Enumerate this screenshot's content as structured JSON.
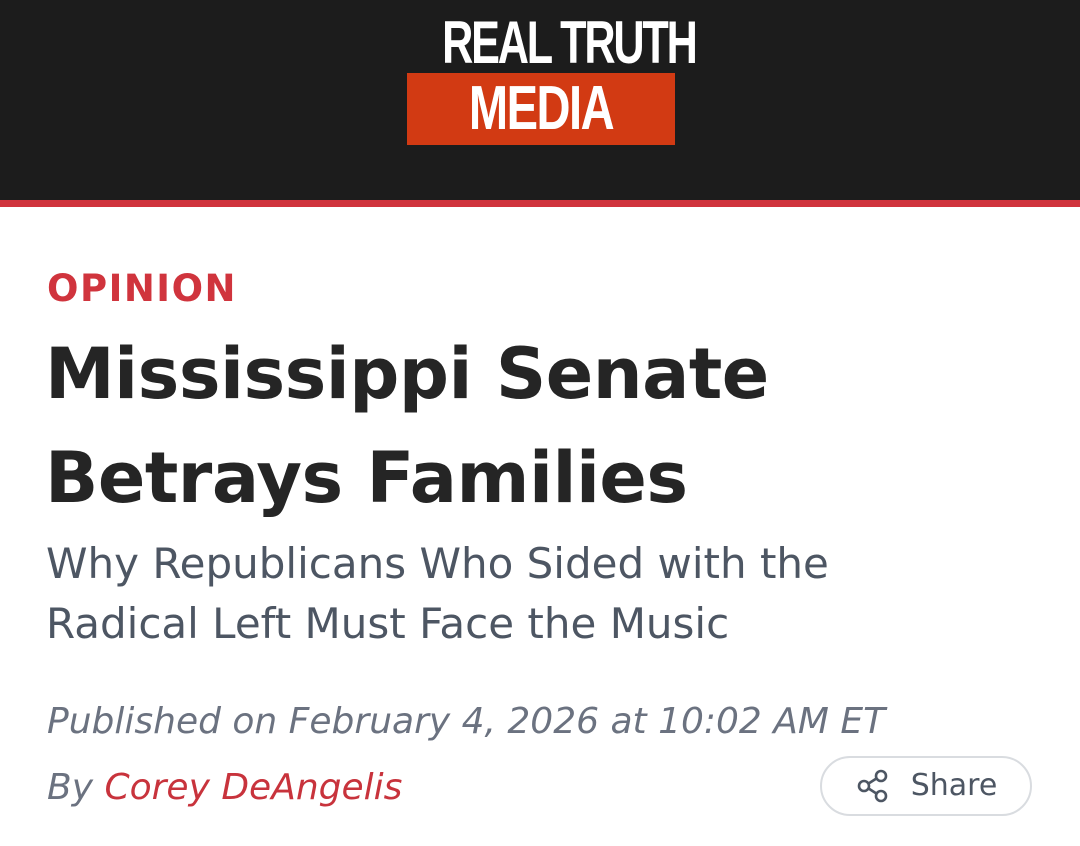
{
  "header": {
    "logo_line1": "REAL TRUTH",
    "logo_line2": "MEDIA",
    "accent_color": "#d23a13",
    "background_color": "#1c1c1c",
    "divider_color": "#d0343d"
  },
  "article": {
    "category": "OPINION",
    "headline_line1": "Mississippi Senate",
    "headline_line2": "Betrays Families",
    "subheadline_line1": "Why Republicans Who Sided with the",
    "subheadline_line2": "Radical Left Must Face the Music",
    "published": "Published on February 4, 2026 at 10:02 AM ET",
    "byline_prefix": "By",
    "author": "Corey DeAngelis",
    "category_color": "#d0343d"
  },
  "share": {
    "label": "Share",
    "icon": "share-icon"
  }
}
